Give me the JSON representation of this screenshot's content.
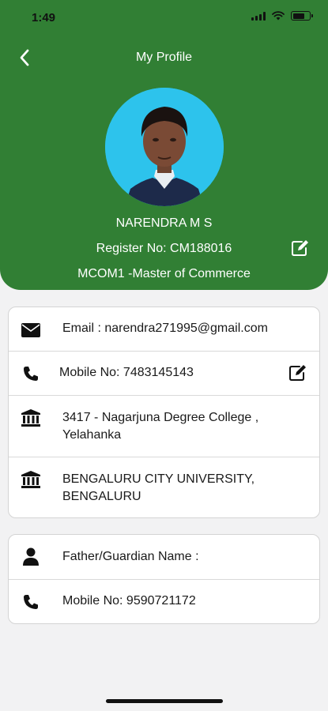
{
  "status_bar": {
    "time": "1:49"
  },
  "header": {
    "title": "My Profile",
    "name": "NARENDRA M S",
    "register_no": "Register No: CM188016",
    "course": "MCOM1 -Master of Commerce"
  },
  "contact_card": {
    "email": "Email : narendra271995@gmail.com",
    "mobile": "Mobile No: 7483145143",
    "college_line1": "3417 - Nagarjuna Degree College ,",
    "college_line2": "Yelahanka",
    "university_line1": "BENGALURU CITY UNIVERSITY,",
    "university_line2": "BENGALURU"
  },
  "guardian_card": {
    "guardian_name": "Father/Guardian Name :",
    "guardian_mobile": "Mobile No: 9590721172"
  },
  "icons": {
    "back": "chevron-left-icon",
    "edit": "edit-icon",
    "email": "envelope-icon",
    "phone": "phone-icon",
    "institution": "bank-icon",
    "person": "person-icon"
  },
  "colors": {
    "header_green": "#317f34",
    "avatar_bg": "#2dc3ec",
    "page_bg": "#f2f2f3"
  }
}
